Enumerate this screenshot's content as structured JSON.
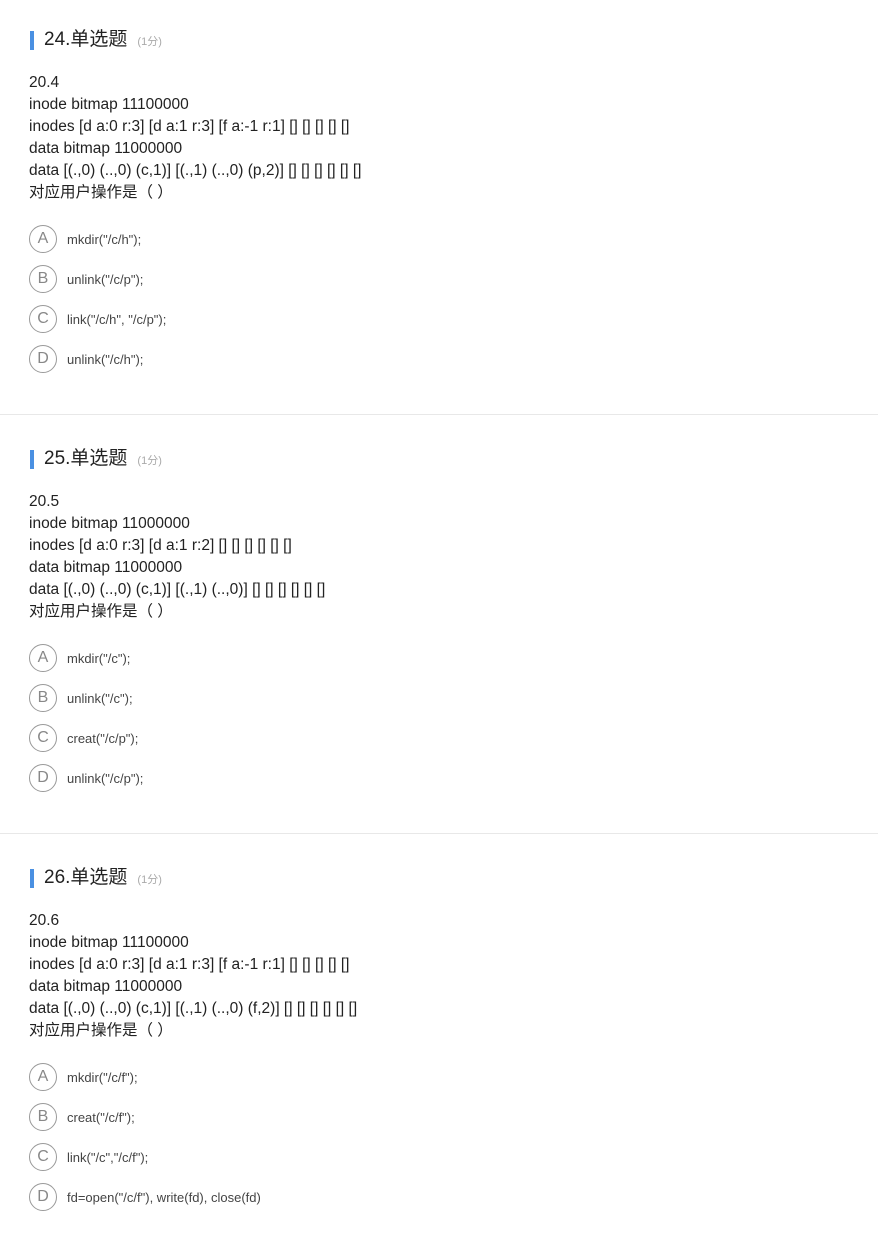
{
  "questions": [
    {
      "title": "24.单选题",
      "score": "(1分)",
      "stem": [
        "20.4",
        "inode bitmap 11100000",
        "inodes [d a:0 r:3] [d a:1 r:3] [f a:-1 r:1] [] [] [] [] []",
        "data bitmap 11000000",
        "data [(.,0) (..,0) (c,1)] [(.,1) (..,0) (p,2)] [] [] [] [] [] []",
        "对应用户操作是（ ）"
      ],
      "options": [
        {
          "letter": "A",
          "text": "mkdir(\"/c/h\");"
        },
        {
          "letter": "B",
          "text": "unlink(\"/c/p\");"
        },
        {
          "letter": "C",
          "text": "link(\"/c/h\", \"/c/p\");"
        },
        {
          "letter": "D",
          "text": "unlink(\"/c/h\");"
        }
      ]
    },
    {
      "title": "25.单选题",
      "score": "(1分)",
      "stem": [
        "20.5",
        "inode bitmap 11000000",
        "inodes [d a:0 r:3] [d a:1 r:2] [] [] [] [] [] []",
        "data bitmap 11000000",
        "data [(.,0) (..,0) (c,1)] [(.,1) (..,0)] [] [] [] [] [] []",
        "对应用户操作是（ ）"
      ],
      "options": [
        {
          "letter": "A",
          "text": "mkdir(\"/c\");"
        },
        {
          "letter": "B",
          "text": "unlink(\"/c\");"
        },
        {
          "letter": "C",
          "text": "creat(\"/c/p\");"
        },
        {
          "letter": "D",
          "text": "unlink(\"/c/p\");"
        }
      ]
    },
    {
      "title": "26.单选题",
      "score": "(1分)",
      "stem": [
        "20.6",
        "inode bitmap 11100000",
        "inodes [d a:0 r:3] [d a:1 r:3] [f a:-1 r:1] [] [] [] [] []",
        "data bitmap 11000000",
        "data [(.,0) (..,0) (c,1)] [(.,1) (..,0) (f,2)] [] [] [] [] [] []",
        "对应用户操作是（ ）"
      ],
      "options": [
        {
          "letter": "A",
          "text": "mkdir(\"/c/f\");"
        },
        {
          "letter": "B",
          "text": "creat(\"/c/f\");"
        },
        {
          "letter": "C",
          "text": "link(\"/c\",\"/c/f\");"
        },
        {
          "letter": "D",
          "text": "fd=open(\"/c/f\"), write(fd), close(fd)"
        }
      ]
    }
  ],
  "colors": {
    "accent": "#4a90e2",
    "divider": "#e8e8e8"
  }
}
